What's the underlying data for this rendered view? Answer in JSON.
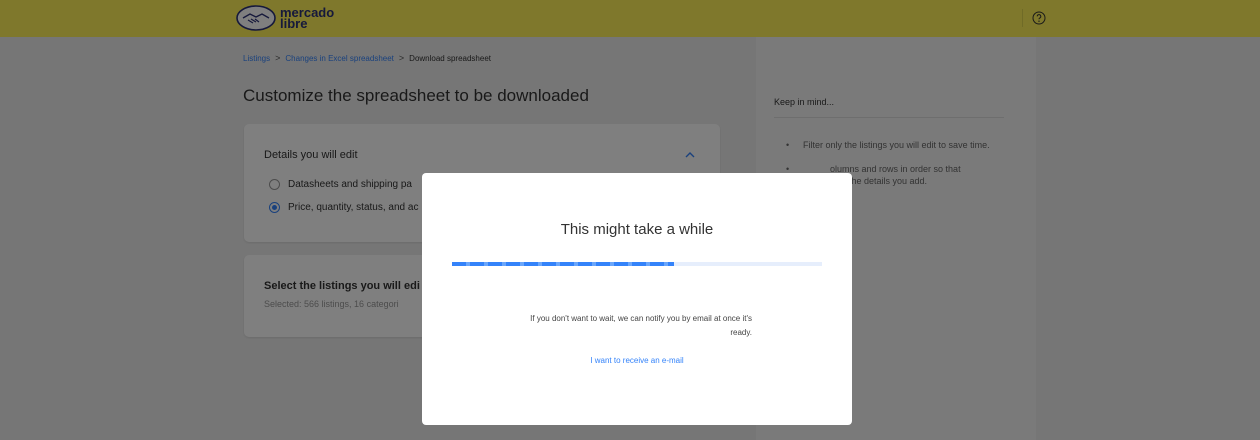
{
  "header": {
    "logo_line1": "mercado",
    "logo_line2": "libre",
    "help_icon": "question-circle-icon"
  },
  "breadcrumb": {
    "items": [
      "Listings",
      "Changes in Excel spreadsheet",
      "Download spreadsheet"
    ],
    "separator": ">"
  },
  "main": {
    "title": "Customize the spreadsheet to be downloaded",
    "details_card": {
      "title": "Details you will edit",
      "options": [
        {
          "label": "Datasheets and shipping pa",
          "checked": false
        },
        {
          "label": "Price, quantity, status, and ac",
          "checked": true
        }
      ]
    },
    "listings_card": {
      "title": "Select the listings you will edi",
      "selected_text": "Selected: 566 listings, 16 categori"
    }
  },
  "aside": {
    "title": "Keep in mind...",
    "tips": [
      "Filter only the listings you will edit to save time.",
      "olumns and rows in order so that\nntify the details you add."
    ]
  },
  "modal": {
    "title": "This might take a while",
    "progress": 0.6,
    "message": "If you don't want to wait, we can notify you by email at once it's ready.",
    "link": "I want to receive an e-mail"
  },
  "colors": {
    "header_bg": "#fff159",
    "accent": "#3483fa"
  }
}
